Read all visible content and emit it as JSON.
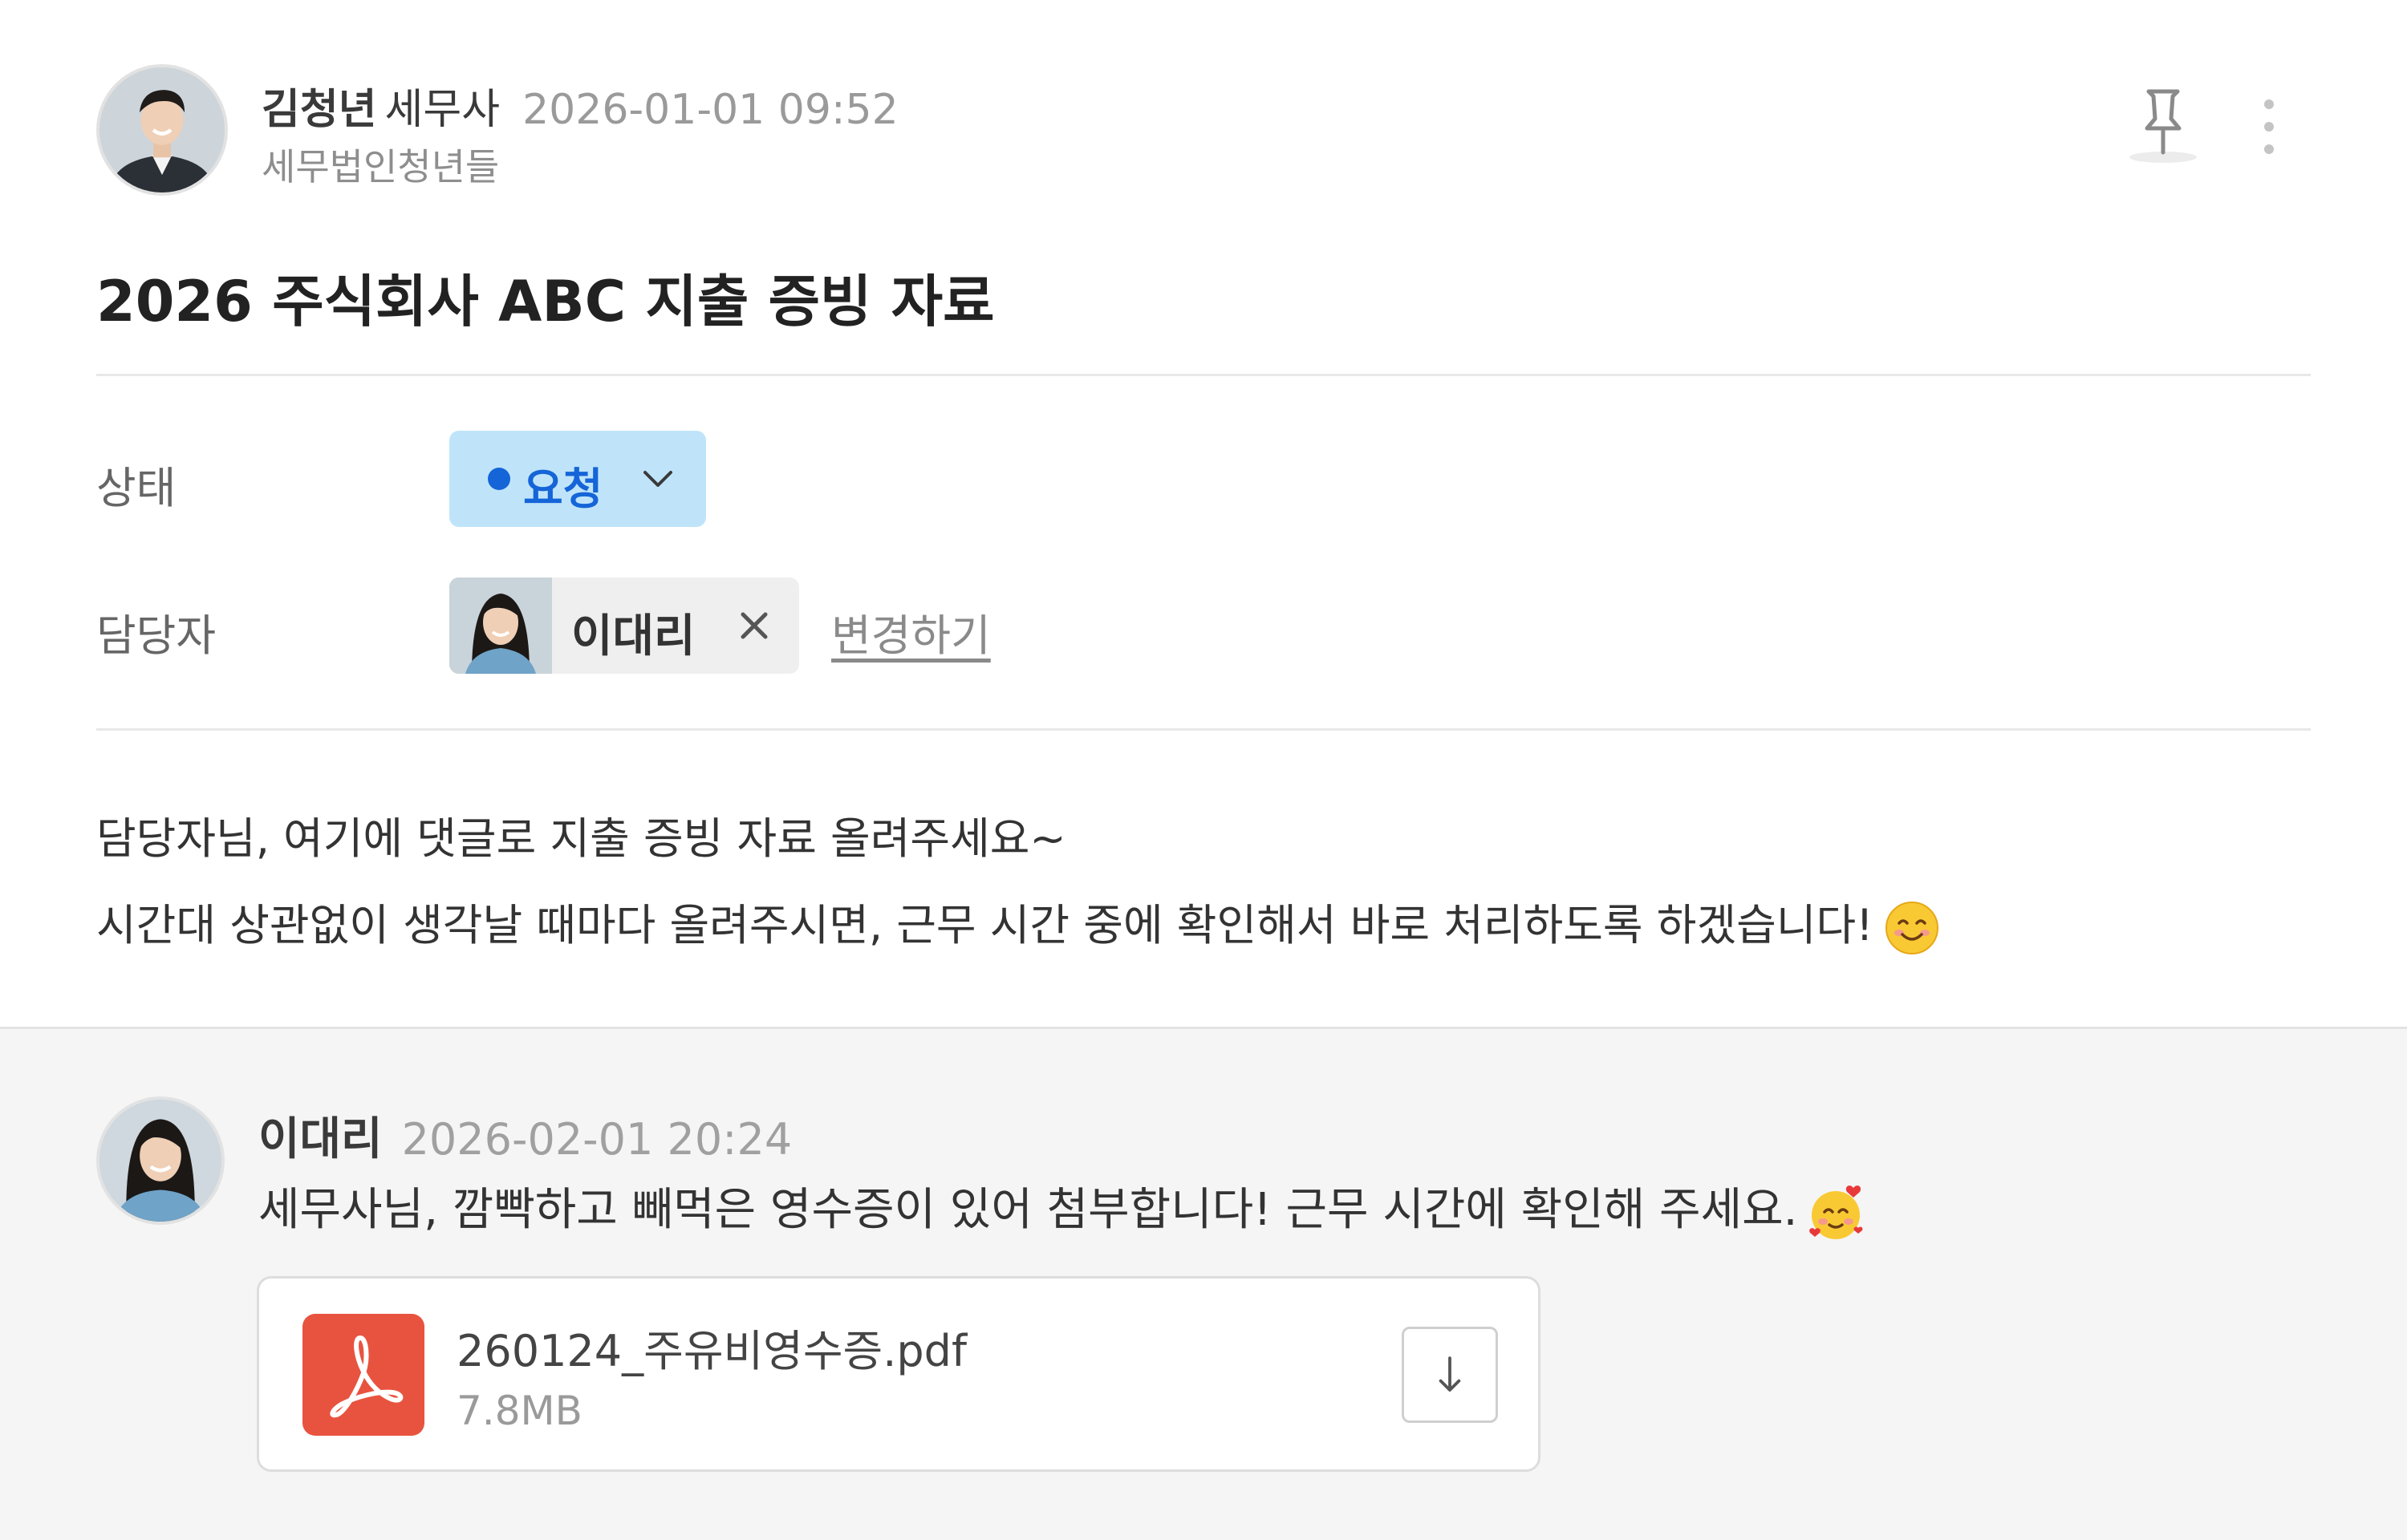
{
  "post": {
    "author": {
      "name": "김청년",
      "role": "세무사",
      "firm": "세무법인청년들",
      "timestamp": "2026-01-01 09:52",
      "avatar": "male-professional-portrait"
    },
    "title": "2026 주식회사 ABC 지출 증빙 자료",
    "actions": {
      "pin_icon": "pushpin-icon",
      "more_icon": "vertical-ellipsis-icon"
    },
    "fields": {
      "status": {
        "label": "상태",
        "value": "요청",
        "dot_color": "#1565d8",
        "background": "#bfe4fa",
        "icon": "chevron-down-icon"
      },
      "assignee": {
        "label": "담당자",
        "name": "이대리",
        "avatar": "female-professional-portrait",
        "remove_icon": "close-icon",
        "change_link": "변경하기"
      }
    },
    "body": {
      "line1": "담당자님, 여기에 댓글로 지출 증빙 자료 올려주세요~",
      "line2": "시간대 상관없이 생각날 때마다 올려주시면, 근무 시간 중에 확인해서 바로 처리하도록 하겠습니다!",
      "line2_emoji": "smiling-face-emoji"
    }
  },
  "comments": [
    {
      "author": "이대리",
      "timestamp": "2026-02-01 20:24",
      "avatar": "female-professional-portrait",
      "text": "세무사님, 깜빡하고 빼먹은 영수증이 있어 첨부합니다! 근무 시간에 확인해 주세요.",
      "text_emoji": "smiling-face-with-hearts-emoji",
      "attachment": {
        "file_name": "260124_주유비영수증.pdf",
        "file_size": "7.8MB",
        "file_icon": "pdf-icon",
        "file_icon_color": "#e8533f",
        "download_icon": "download-arrow-icon"
      }
    }
  ]
}
